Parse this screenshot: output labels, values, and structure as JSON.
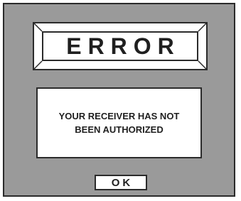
{
  "dialog": {
    "title": "ERROR",
    "message_lines": [
      "YOUR RECEIVER HAS NOT",
      "BEEN AUTHORIZED"
    ],
    "ok_label": "OK"
  },
  "colors": {
    "dialog_background": "#9a9a9a",
    "panel_background": "#ffffff",
    "border": "#2b2b2b",
    "text": "#1f1f1f"
  }
}
